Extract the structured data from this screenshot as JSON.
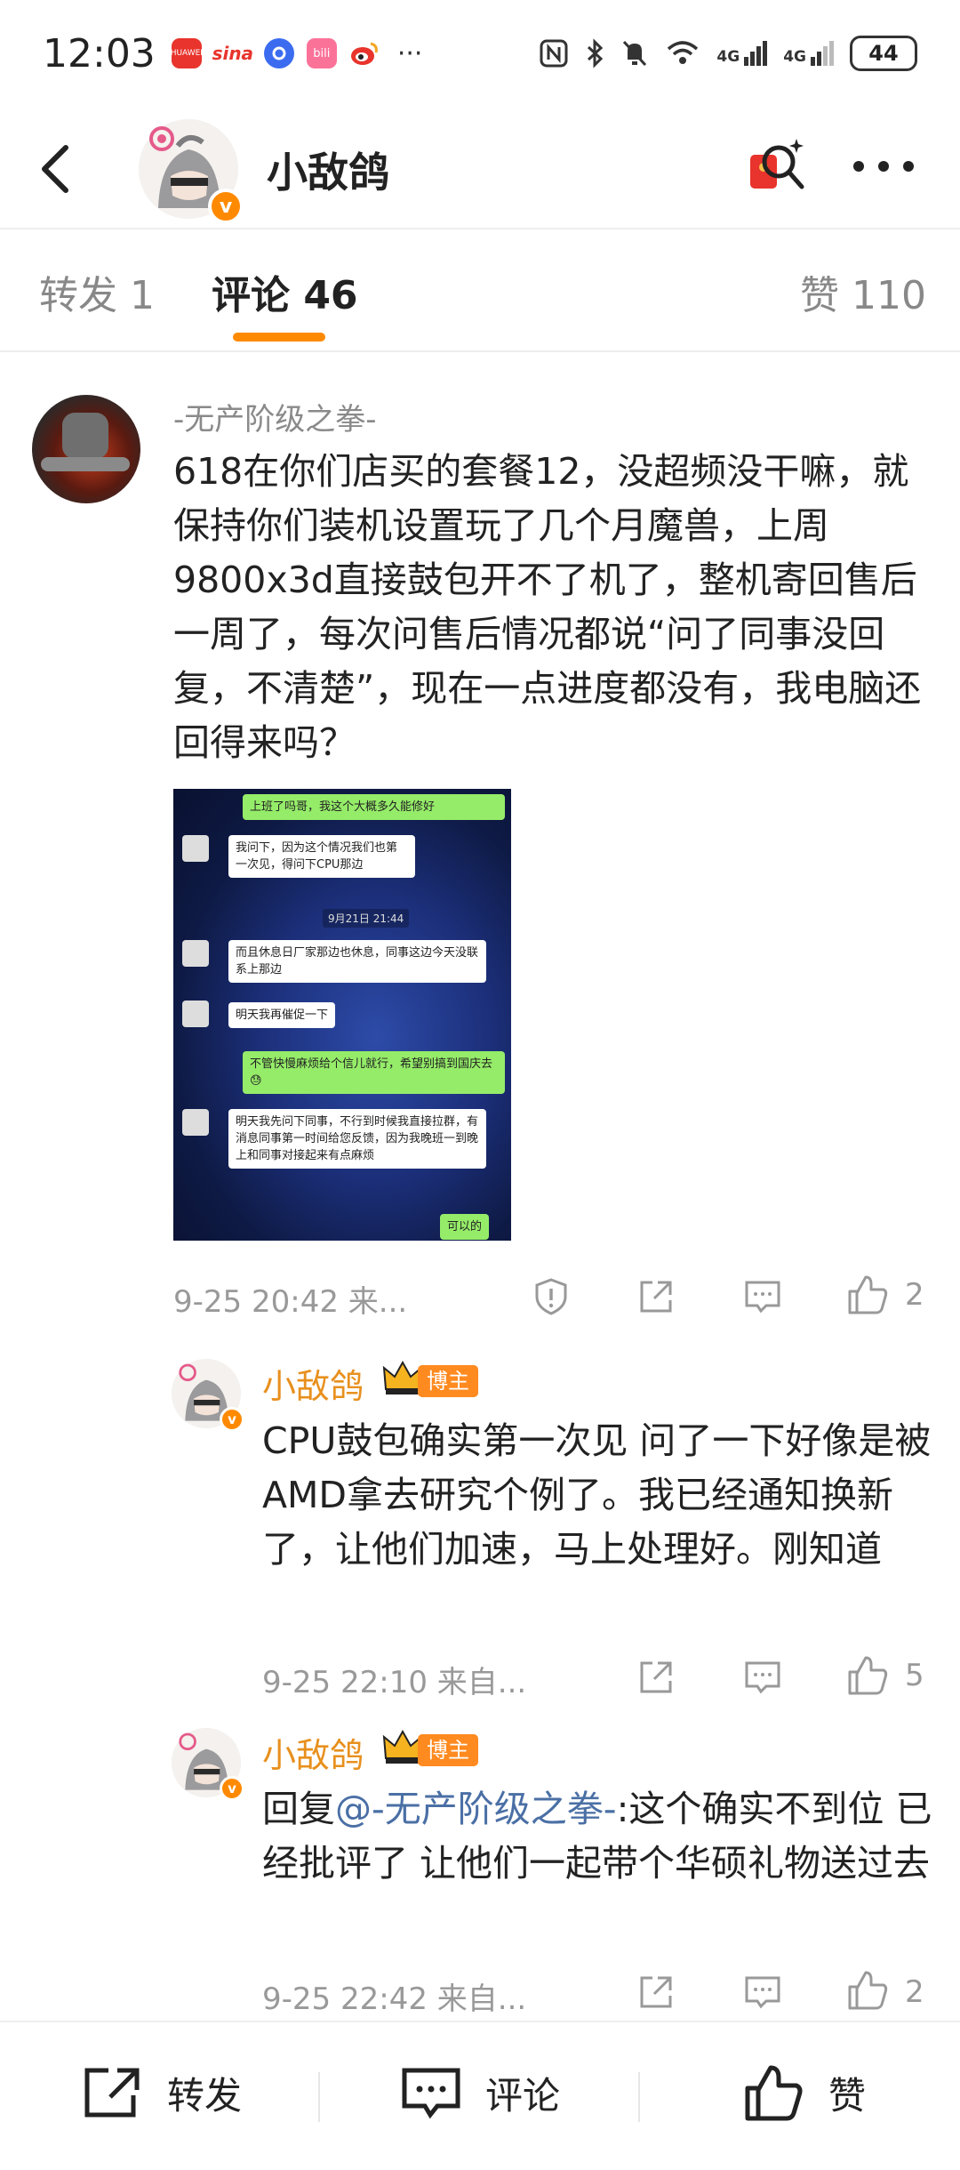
{
  "status_bar": {
    "time": "12:03",
    "apps": [
      {
        "name": "huawei-mall-icon",
        "label": "HUAWEI",
        "color": "#e8342c"
      },
      {
        "name": "sina-icon",
        "label": "sina",
        "color": "#e8342c"
      },
      {
        "name": "browser-icon",
        "label": "",
        "color": "#3b6cf0"
      },
      {
        "name": "bilibili-icon",
        "label": "bili",
        "color": "#fb7299"
      },
      {
        "name": "weibo-icon",
        "label": "",
        "color": "#f5a623"
      }
    ],
    "more": "···",
    "network_1": "4G",
    "network_2": "4G",
    "battery": "44"
  },
  "header": {
    "title": "小敌鸽",
    "verified_badge": "v"
  },
  "tabs": [
    {
      "label": "转发 1"
    },
    {
      "label": "评论 46"
    },
    {
      "label": "赞 110"
    }
  ],
  "comment": {
    "username": "-无产阶级之拳-",
    "text": "618在你们店买的套餐12，没超频没干嘛，就保持你们装机设置玩了几个月魔兽，上周9800x3d直接鼓包开不了机了，整机寄回售后一周了，每次问售后情况都说“问了同事没回复，不清楚”，现在一点进度都没有，我电脑还回得来吗？",
    "chat_image": {
      "messages": [
        "上班了吗哥，我这个大概多久能修好",
        "我问下，因为这个情况我们也第一次见，得问下CPU那边",
        "9月21日 21:44",
        "而且休息日厂家那边也休息，同事这边今天没联系上那边",
        "明天我再催促一下",
        "不管快慢麻烦给个信儿就行，希望别搞到国庆去😓",
        "明天我先问下同事，不行到时候我直接拉群，有消息同事第一时间给您反馈，因为我晚班一到晚上和同事对接起来有点麻烦",
        "可以的"
      ]
    },
    "meta": "9-25 20:42  来...",
    "likes": "2"
  },
  "replies": [
    {
      "name": "小敌鸽",
      "badge": "博主",
      "text": "CPU鼓包确实第一次见 问了一下好像是被AMD拿去研究个例了。我已经通知换新了，让他们加速，马上处理好。刚知道",
      "meta": "9-25 22:10  来自...",
      "likes": "5"
    },
    {
      "name": "小敌鸽",
      "badge": "博主",
      "reply_prefix": "回复",
      "mention": "@-无产阶级之拳-",
      "text": ":这个确实不到位 已经批评了 让他们一起带个华硕礼物送过去",
      "meta": "9-25 22:42  来自...",
      "likes": "2"
    }
  ],
  "bottom_bar": {
    "repost": "转发",
    "comment": "评论",
    "like": "赞"
  },
  "colors": {
    "accent": "#ff8a00",
    "author_name": "#e8901e",
    "mention": "#4a6fa5"
  }
}
